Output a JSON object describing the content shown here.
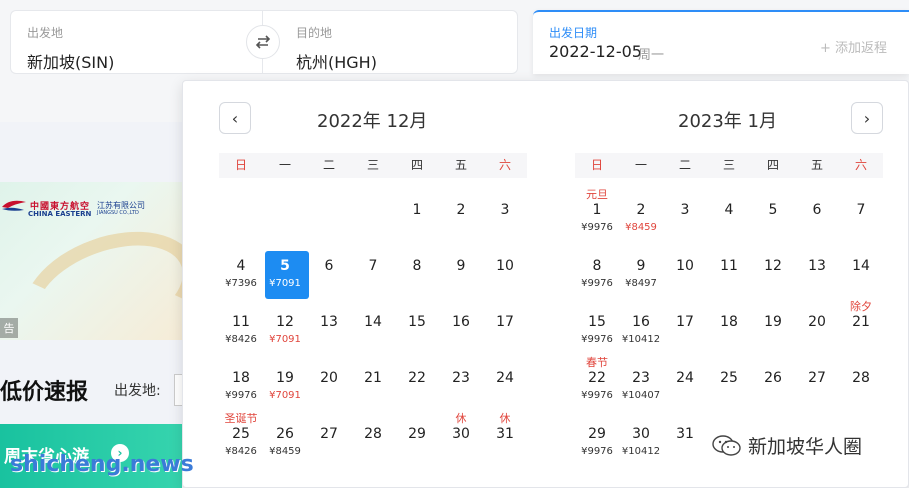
{
  "search": {
    "from_label": "出发地",
    "from_value": "新加坡(SIN)",
    "to_label": "目的地",
    "to_value": "杭州(HGH)",
    "swap_icon": "swap-arrows-icon",
    "date_label": "出发日期",
    "date_value": "2022-12-05",
    "weekday": "周一",
    "add_return": "+ 添加返程"
  },
  "background": {
    "airline_cn": "中國東方航空",
    "airline_en": "CHINA EASTERN",
    "branch_cn": "江苏有限公司",
    "branch_en": "JIANGSU CO.,LTD",
    "ad_tag": "告",
    "promo_title": "低价速报",
    "promo_from_label": "出发地:",
    "green_banner": "周末省心游",
    "green_arrow": "›"
  },
  "calendar": {
    "prev_icon": "‹",
    "next_icon": "›",
    "weekdays": [
      "日",
      "一",
      "二",
      "三",
      "四",
      "五",
      "六"
    ],
    "weekend_color": "#e0453c",
    "accent": "#1d8cf2",
    "months": [
      {
        "title": "2022年 12月",
        "first_weekday": 4,
        "days": [
          {
            "d": "1"
          },
          {
            "d": "2"
          },
          {
            "d": "3"
          },
          {
            "d": "4",
            "price": "¥7396"
          },
          {
            "d": "5",
            "price": "¥7091",
            "selected": true
          },
          {
            "d": "6"
          },
          {
            "d": "7"
          },
          {
            "d": "8"
          },
          {
            "d": "9"
          },
          {
            "d": "10"
          },
          {
            "d": "11",
            "price": "¥8426"
          },
          {
            "d": "12",
            "price": "¥7091",
            "low": true
          },
          {
            "d": "13"
          },
          {
            "d": "14"
          },
          {
            "d": "15"
          },
          {
            "d": "16"
          },
          {
            "d": "17"
          },
          {
            "d": "18",
            "price": "¥9976"
          },
          {
            "d": "19",
            "price": "¥7091",
            "low": true
          },
          {
            "d": "20"
          },
          {
            "d": "21"
          },
          {
            "d": "22"
          },
          {
            "d": "23"
          },
          {
            "d": "24"
          },
          {
            "d": "25",
            "price": "¥8426",
            "hol": "圣诞节"
          },
          {
            "d": "26",
            "price": "¥8459"
          },
          {
            "d": "27"
          },
          {
            "d": "28"
          },
          {
            "d": "29"
          },
          {
            "d": "30",
            "hol": "休"
          },
          {
            "d": "31",
            "hol": "休"
          }
        ]
      },
      {
        "title": "2023年 1月",
        "first_weekday": 0,
        "days": [
          {
            "d": "1",
            "price": "¥9976",
            "hol": "元旦"
          },
          {
            "d": "2",
            "price": "¥8459",
            "low": true
          },
          {
            "d": "3"
          },
          {
            "d": "4"
          },
          {
            "d": "5"
          },
          {
            "d": "6"
          },
          {
            "d": "7"
          },
          {
            "d": "8",
            "price": "¥9976"
          },
          {
            "d": "9",
            "price": "¥8497"
          },
          {
            "d": "10"
          },
          {
            "d": "11"
          },
          {
            "d": "12"
          },
          {
            "d": "13"
          },
          {
            "d": "14"
          },
          {
            "d": "15",
            "price": "¥9976"
          },
          {
            "d": "16",
            "price": "¥10412"
          },
          {
            "d": "17"
          },
          {
            "d": "18"
          },
          {
            "d": "19"
          },
          {
            "d": "20"
          },
          {
            "d": "21",
            "hol": "除夕"
          },
          {
            "d": "22",
            "price": "¥9976",
            "hol": "春节"
          },
          {
            "d": "23",
            "price": "¥10407"
          },
          {
            "d": "24"
          },
          {
            "d": "25"
          },
          {
            "d": "26"
          },
          {
            "d": "27"
          },
          {
            "d": "28"
          },
          {
            "d": "29",
            "price": "¥9976"
          },
          {
            "d": "30",
            "price": "¥10412"
          },
          {
            "d": "31"
          }
        ]
      }
    ]
  },
  "watermarks": {
    "right": "新加坡华人圈",
    "left": "shicheng.news"
  }
}
